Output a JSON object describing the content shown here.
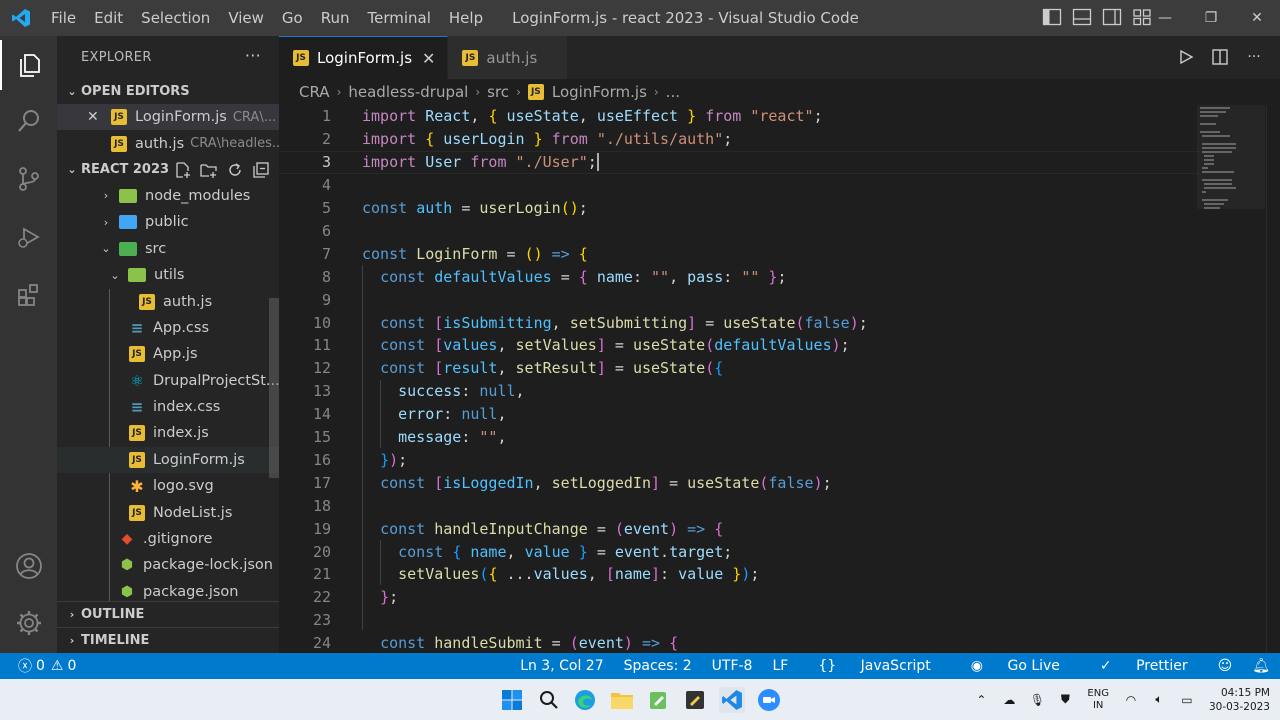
{
  "titlebar": {
    "menu": [
      "File",
      "Edit",
      "Selection",
      "View",
      "Go",
      "Run",
      "Terminal",
      "Help"
    ],
    "window_title": "LoginForm.js - react 2023 - Visual Studio Code"
  },
  "explorer": {
    "title": "EXPLORER",
    "more": "···",
    "open_editors": {
      "title": "OPEN EDITORS",
      "items": [
        {
          "name": "LoginForm.js",
          "desc": "CRA\\...",
          "close": "✕"
        },
        {
          "name": "auth.js",
          "desc": "CRA\\headles..."
        }
      ]
    },
    "workspace": {
      "title": "REACT 2023",
      "tree": [
        {
          "name": "node_modules",
          "type": "folder"
        },
        {
          "name": "public",
          "type": "folder"
        },
        {
          "name": "src",
          "type": "folder"
        },
        {
          "name": "utils",
          "type": "folder"
        },
        {
          "name": "auth.js",
          "type": "js"
        },
        {
          "name": "App.css",
          "type": "css"
        },
        {
          "name": "App.js",
          "type": "js"
        },
        {
          "name": "DrupalProjectSt...",
          "type": "react"
        },
        {
          "name": "index.css",
          "type": "css"
        },
        {
          "name": "index.js",
          "type": "js"
        },
        {
          "name": "LoginForm.js",
          "type": "js"
        },
        {
          "name": "logo.svg",
          "type": "svg"
        },
        {
          "name": "NodeList.js",
          "type": "js"
        },
        {
          "name": ".gitignore",
          "type": "git"
        },
        {
          "name": "package-lock.json",
          "type": "pkg"
        },
        {
          "name": "package.json",
          "type": "pkg"
        }
      ]
    },
    "outline": "OUTLINE",
    "timeline": "TIMELINE"
  },
  "tabs": [
    {
      "label": "LoginForm.js",
      "active": true,
      "close": "✕"
    },
    {
      "label": "auth.js",
      "active": false
    }
  ],
  "breadcrumb": [
    "CRA",
    "headless-drupal",
    "src",
    "LoginForm.js",
    "..."
  ],
  "editor": {
    "current_line": 3,
    "line_numbers": [
      "1",
      "2",
      "3",
      "4",
      "5",
      "6",
      "7",
      "8",
      "9",
      "10",
      "11",
      "12",
      "13",
      "14",
      "15",
      "16",
      "17",
      "18",
      "19",
      "20",
      "21",
      "22",
      "23",
      "24"
    ]
  },
  "statusbar": {
    "errors": "0",
    "warnings": "0",
    "position": "Ln 3, Col 27",
    "spaces": "Spaces: 2",
    "encoding": "UTF-8",
    "eol": "LF",
    "language": "JavaScript",
    "golive": "Go Live",
    "prettier": "Prettier"
  },
  "taskbar": {
    "lang_top": "ENG",
    "lang_bottom": "IN",
    "time": "04:15 PM",
    "date": "30-03-2023"
  },
  "colors": {
    "accent": "#007acc",
    "sidebar": "#252526",
    "editor": "#1e1e1e",
    "activitybar": "#333333"
  }
}
